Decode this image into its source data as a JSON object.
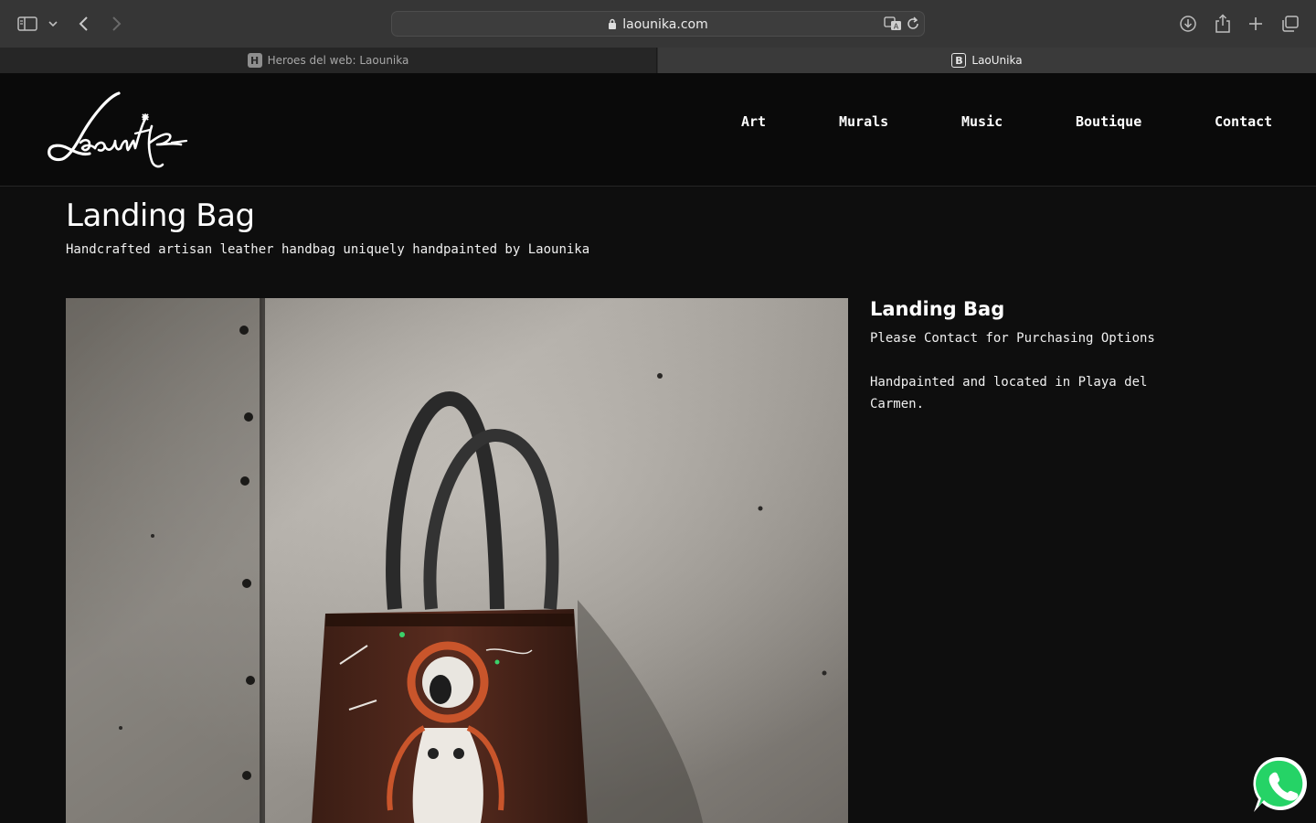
{
  "browser": {
    "url": "laounika.com",
    "tabs": [
      {
        "label": "Heroes del web: Laounika",
        "favicon": "H",
        "active": false
      },
      {
        "label": "LaoUnika",
        "favicon": "B",
        "active": true
      }
    ],
    "icons": {
      "sidebar": "sidebar-icon",
      "dropdown": "chevron-down-icon",
      "back": "back-arrow-icon",
      "forward": "forward-arrow-icon",
      "lock": "lock-icon",
      "translate": "translate-icon",
      "reload": "reload-icon",
      "downloads": "download-icon",
      "share": "share-icon",
      "new_tab": "plus-icon",
      "tab_overview": "tabs-icon"
    }
  },
  "site": {
    "logo_text": "Laounika",
    "nav": [
      "Art",
      "Murals",
      "Music",
      "Boutique",
      "Contact"
    ]
  },
  "page": {
    "title": "Landing Bag",
    "subtitle": "Handcrafted artisan leather handbag uniquely handpainted by Laounika"
  },
  "product": {
    "title": "Landing Bag",
    "purchase_note": "Please Contact for Purchasing Options",
    "location_note": "Handpainted and located in Playa del Carmen."
  },
  "colors": {
    "background": "#0e0e0e",
    "header": "#0a0a0a",
    "whatsapp": "#25d366"
  }
}
